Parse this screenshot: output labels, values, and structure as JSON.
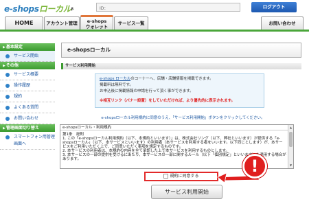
{
  "header": {
    "logo_main": "e-shops",
    "logo_accent": "ローカル",
    "logo_suffix": "β",
    "id_label": "ID：",
    "logout_label": "ログアウト"
  },
  "nav": {
    "tabs": [
      {
        "label": "HOME"
      },
      {
        "label": "アカウント管理"
      },
      {
        "label_line1": "e-shops",
        "label_line2": "ウォレット"
      },
      {
        "label": "サービス一覧"
      },
      {
        "label": "お問い合わせ"
      }
    ]
  },
  "sidebar": {
    "sections": [
      {
        "title": "基本設定",
        "items": [
          {
            "label": "サービス開始"
          }
        ]
      },
      {
        "title": "その他",
        "items": [
          {
            "label": "サービス概要"
          },
          {
            "label": "操作履歴"
          },
          {
            "label": "規約"
          },
          {
            "label": "よくある質問"
          },
          {
            "label": "お問い合わせ"
          }
        ]
      },
      {
        "title": "管理画面切り替え",
        "items": [
          {
            "label": "スマートフォン用管理画面へ"
          }
        ]
      }
    ]
  },
  "main": {
    "panel_title": "e-shopsローカル",
    "sub_title": "サービス利用開始",
    "info_link": "e-shops ローカル",
    "info_line1_rest": "のコーナーへ、店舗・店舗情報を掲載できます。",
    "info_line2": "掲載料は無料です。",
    "info_line3": "お申込後に掲載情報の申請を行って頂く事ができます。",
    "info_warn": "※相互リンク（バナー設置）をしていただければ、より優先的に表示されます。",
    "agree_msg": "e-shopsローカル利用規約に同意のうえ、「サービス利用開始」ボタンをクリックしてください。",
    "terms_title": "e-shopsローカル・利用規約",
    "terms_body": "第1条　総則\n1. この「e-shopsローカル利用規約（以下、本規約といいます）」は、株式会社リング（以下、弊社といいます）が提供する「e-shopsローカル」（以下、本サービスといいます）の利用者（本サービスを利用する者をいいます。以下同じとします）が、本サービスをご利用いただく上で、ご同意いただく事項を規定するものです。\n2. 本サービスの利用者は、本規約の内容を全て承認した上で本サービスを利用するものとします。\n3. 本サービスの一部の提供を受けるにあたり、本サービスの一部に関するルール（以下「個別規定」といいます）を適用する場合があります。",
    "agree_checkbox_label": "規約に同意する",
    "start_button": "サービス利用開始",
    "alert_badge": "!"
  },
  "colors": {
    "accent_green": "#3b9a2f",
    "link_blue": "#1a55a0",
    "alert_red": "#e01f1f"
  }
}
